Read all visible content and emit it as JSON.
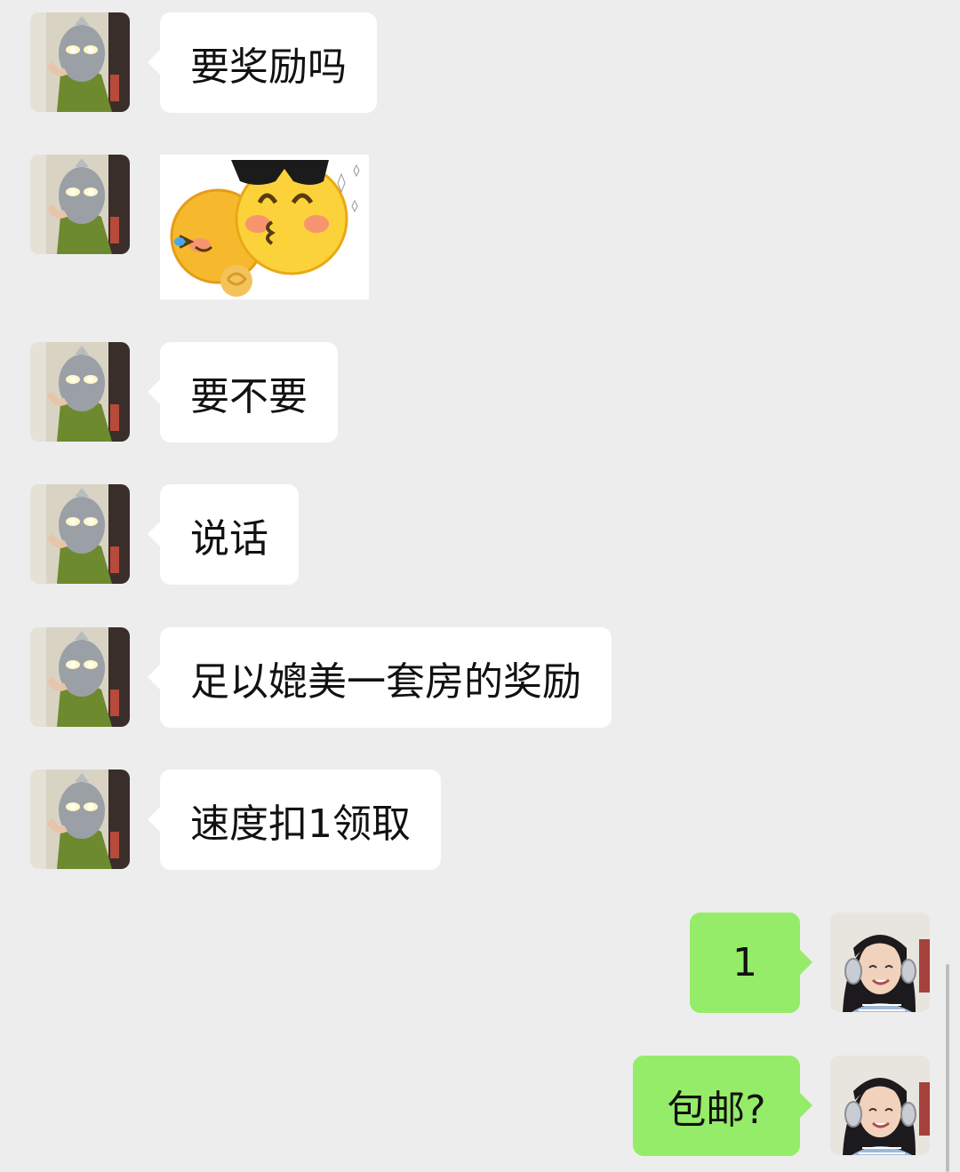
{
  "messages": [
    {
      "id": "m1",
      "sender": "other",
      "type": "text",
      "text": "要奖励吗"
    },
    {
      "id": "m2",
      "sender": "other",
      "type": "sticker",
      "sticker": "sunglasses-kiss-emoji-sticker"
    },
    {
      "id": "m3",
      "sender": "other",
      "type": "text",
      "text": "要不要"
    },
    {
      "id": "m4",
      "sender": "other",
      "type": "text",
      "text": "说话"
    },
    {
      "id": "m5",
      "sender": "other",
      "type": "text",
      "text": "足以媲美一套房的奖励"
    },
    {
      "id": "m6",
      "sender": "other",
      "type": "text",
      "text": "速度扣1领取"
    },
    {
      "id": "m7",
      "sender": "self",
      "type": "text",
      "text": "1"
    },
    {
      "id": "m8",
      "sender": "self",
      "type": "text",
      "text": "包邮?"
    }
  ],
  "colors": {
    "background": "#ededed",
    "incoming_bubble": "#ffffff",
    "outgoing_bubble": "#95ec69"
  },
  "icons": {
    "other_avatar": "ultraman-mask-avatar",
    "self_avatar": "girl-headphones-avatar"
  }
}
